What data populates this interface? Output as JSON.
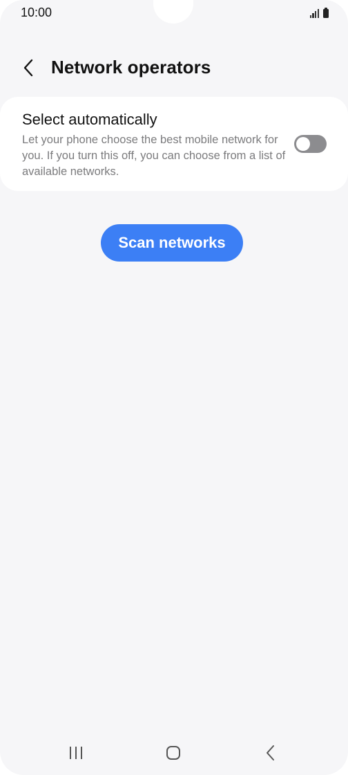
{
  "status_bar": {
    "time": "10:00",
    "signal_icon": "signal-bars-icon",
    "battery_icon": "battery-full-icon"
  },
  "header": {
    "back_icon": "chevron-left-icon",
    "title": "Network operators"
  },
  "settings": {
    "select_automatically": {
      "title": "Select automatically",
      "summary": "Let your phone choose the best mobile network for you. If you turn this off, you can choose from a list of available networks.",
      "enabled": false
    }
  },
  "actions": {
    "scan_label": "Scan networks"
  },
  "nav_bar": {
    "recents_icon": "recents-icon",
    "home_icon": "home-icon",
    "back_icon": "back-icon"
  },
  "colors": {
    "background": "#f6f6f8",
    "card": "#ffffff",
    "accent": "#3c7ff5",
    "toggle_off": "#8c8c8f",
    "secondary_text": "#7b7b7d"
  }
}
